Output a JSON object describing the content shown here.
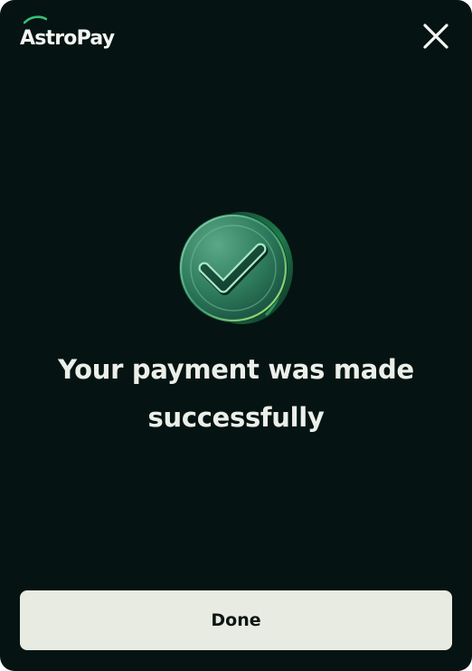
{
  "brand": {
    "name": "AstroPay",
    "swoosh_icon": "astropay-swoosh-icon",
    "swoosh_color": "#35c07a"
  },
  "header": {
    "close_icon": "close-icon"
  },
  "status": {
    "icon": "check-circle-icon",
    "accent_color": "#2a8a5c",
    "message": "Your payment was made successfully"
  },
  "footer": {
    "done_label": "Done"
  },
  "colors": {
    "background": "#051412",
    "text": "#ecefe9",
    "button_bg": "#e7ebe1",
    "button_text": "#0d1614"
  }
}
